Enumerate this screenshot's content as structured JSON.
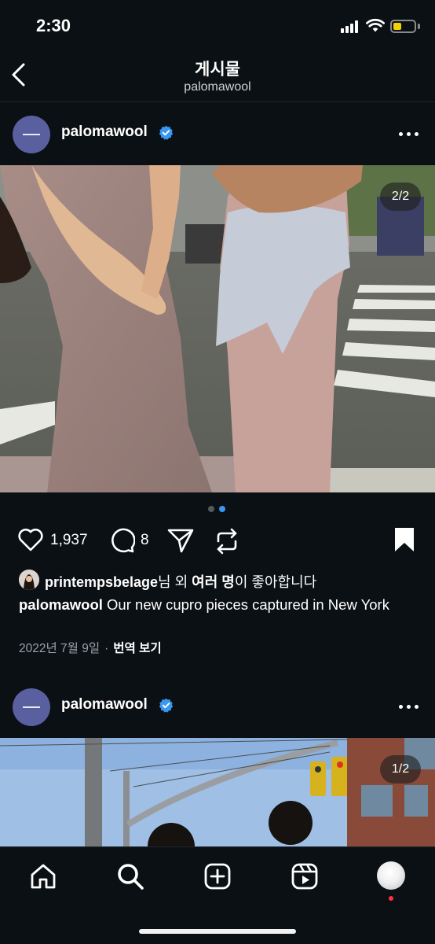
{
  "status_bar": {
    "time": "2:30"
  },
  "header": {
    "title": "게시물",
    "subtitle": "palomawool"
  },
  "post1": {
    "username": "palomawool",
    "counter": "2/2",
    "likes": "1,937",
    "comments": "8",
    "liked_by_user": "printempsbelage",
    "liked_by_mid": "님 외 ",
    "liked_by_others": "여러 명",
    "liked_by_suffix": "이 좋아합니다",
    "caption_user": "palomawool",
    "caption_text": " Our new cupro pieces captured in New York",
    "date": "2022년 7월 9일",
    "separator": "·",
    "translate": "번역 보기",
    "carousel_active_index": 2,
    "carousel_total": 2
  },
  "post2": {
    "username": "palomawool",
    "counter": "1/2"
  },
  "colors": {
    "background": "#0b1014",
    "verified": "#3897f0",
    "active_dot": "#3897f0",
    "inactive_dot": "#55595d",
    "notification": "#ff3040"
  },
  "icons": {
    "back": "chevron-left-icon",
    "more": "more-horizontal-icon",
    "like": "heart-icon",
    "comment": "comment-icon",
    "share": "send-icon",
    "remix": "repost-icon",
    "save": "bookmark-icon",
    "home": "home-icon",
    "search": "search-icon",
    "create": "plus-square-icon",
    "reels": "reels-icon"
  }
}
